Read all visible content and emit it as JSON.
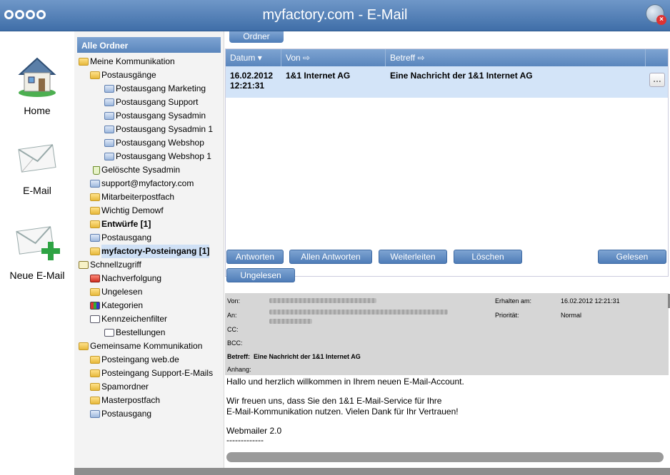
{
  "window": {
    "title": "myfactory.com - E-Mail"
  },
  "leftnav": [
    {
      "label": "Home",
      "icon": "house-icon"
    },
    {
      "label": "E-Mail",
      "icon": "envelope-icon"
    },
    {
      "label": "Neue E-Mail",
      "icon": "new-mail-icon"
    }
  ],
  "tree": {
    "header": "Alle Ordner",
    "nodes": [
      {
        "label": "Meine Kommunikation",
        "indent": 0
      },
      {
        "label": "Postausgänge",
        "indent": 1
      },
      {
        "label": "Postausgang Marketing",
        "indent": 2
      },
      {
        "label": "Postausgang Support",
        "indent": 2
      },
      {
        "label": "Postausgang Sysadmin",
        "indent": 2
      },
      {
        "label": "Postausgang Sysadmin 1",
        "indent": 2
      },
      {
        "label": "Postausgang Webshop",
        "indent": 2
      },
      {
        "label": "Postausgang Webshop 1",
        "indent": 2
      },
      {
        "label": "Gelöschte Sysadmin",
        "indent": 1
      },
      {
        "label": "support@myfactory.com",
        "indent": 1
      },
      {
        "label": "Mitarbeiterpostfach",
        "indent": 1
      },
      {
        "label": "Wichtig Demowf",
        "indent": 1
      },
      {
        "label": "Entwürfe [1]",
        "indent": 1
      },
      {
        "label": "Postausgang",
        "indent": 1
      },
      {
        "label": "myfactory-Posteingang [1]",
        "indent": 1
      },
      {
        "label": "Schnellzugriff",
        "indent": 0
      },
      {
        "label": "Nachverfolgung",
        "indent": 1
      },
      {
        "label": "Ungelesen",
        "indent": 1
      },
      {
        "label": "Kategorien",
        "indent": 1
      },
      {
        "label": "Kennzeichenfilter",
        "indent": 1
      },
      {
        "label": "Bestellungen",
        "indent": 2
      },
      {
        "label": "Gemeinsame Kommunikation",
        "indent": 0
      },
      {
        "label": "Posteingang web.de",
        "indent": 1
      },
      {
        "label": "Posteingang Support-E-Mails",
        "indent": 1
      },
      {
        "label": "Spamordner",
        "indent": 1
      },
      {
        "label": "Masterpostfach",
        "indent": 1
      },
      {
        "label": "Postausgang",
        "indent": 1
      }
    ]
  },
  "ordner_button": "Ordner",
  "grid": {
    "columns": [
      "Datum",
      "Von",
      "Betreff"
    ],
    "rows": [
      {
        "datum": "16.02.2012 12:21:31",
        "von": "1&1 Internet AG",
        "betreff": "Eine Nachricht der 1&1 Internet AG"
      }
    ],
    "row_button": "..."
  },
  "actions": {
    "antworten": "Antworten",
    "allen_antworten": "Allen Antworten",
    "weiterleiten": "Weiterleiten",
    "loeschen": "Löschen",
    "gelesen": "Gelesen",
    "ungelesen": "Ungelesen"
  },
  "mail_header": {
    "von_label": "Von:",
    "an_label": "An:",
    "cc_label": "CC:",
    "bcc_label": "BCC:",
    "betreff_label": "Betreff:",
    "betreff_value": "Eine Nachricht der 1&1 Internet AG",
    "anhang_label": "Anhang:",
    "erhalten_label": "Erhalten am:",
    "erhalten_value": "16.02.2012 12:21:31",
    "prioritaet_label": "Priorität:",
    "prioritaet_value": "Normal"
  },
  "mail_body": {
    "line1": "Hallo und herzlich willkommen in Ihrem neuen E-Mail-Account.",
    "line2": "Wir freuen uns, dass Sie den 1&1 E-Mail-Service für Ihre",
    "line3": "E-Mail-Kommunikation nutzen. Vielen Dank für Ihr Vertrauen!",
    "line4": "Webmailer 2.0",
    "line5": "-------------"
  }
}
